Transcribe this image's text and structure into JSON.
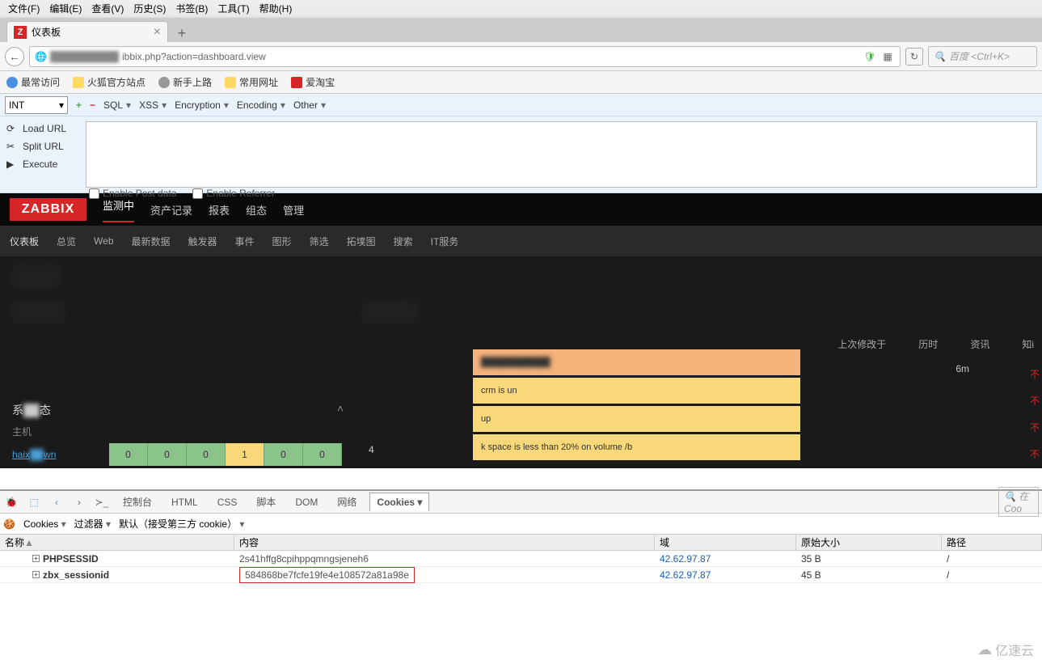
{
  "browser": {
    "menu": [
      "文件(F)",
      "编辑(E)",
      "查看(V)",
      "历史(S)",
      "书签(B)",
      "工具(T)",
      "帮助(H)"
    ],
    "tab_title": "仪表板",
    "url": "ibbix.php?action=dashboard.view",
    "search_placeholder": "百度 <Ctrl+K>",
    "bookmarks": [
      {
        "icon": "bm-blue",
        "label": "最常访问"
      },
      {
        "icon": "bm-folder",
        "label": "火狐官方站点"
      },
      {
        "icon": "bm-grey",
        "label": "新手上路"
      },
      {
        "icon": "bm-folder",
        "label": "常用网址"
      },
      {
        "icon": "bm-red",
        "label": "爱淘宝"
      }
    ]
  },
  "hackbar": {
    "select_value": "INT",
    "menus": [
      "SQL",
      "XSS",
      "Encryption",
      "Encoding",
      "Other"
    ],
    "actions": [
      {
        "label": "Load URL",
        "underline": "L"
      },
      {
        "label": "Split URL",
        "underline": "S"
      },
      {
        "label": "Execute",
        "underline": "E"
      }
    ],
    "opt_post": "Enable Post data",
    "opt_referrer": "Enable Referrer"
  },
  "zabbix": {
    "logo": "ZABBIX",
    "top_nav": [
      "监测中",
      "资产记录",
      "报表",
      "组态",
      "管理"
    ],
    "sub_nav": [
      "仪表板",
      "总览",
      "Web",
      "最新数据",
      "触发器",
      "事件",
      "图形",
      "筛选",
      "拓墣图",
      "搜索",
      "IT服务"
    ],
    "headers": {
      "last_change": "上次修改于",
      "age": "历时",
      "info": "资讯",
      "ack": "知i"
    },
    "age_value": "6m",
    "status_title_partial": "系",
    "status_title_rest": "态",
    "host_label": "主机",
    "host_name_partial1": "haix",
    "host_name_partial2": "wn",
    "status_values": [
      "0",
      "0",
      "0",
      "1",
      "0",
      "0"
    ],
    "extra_val": "4",
    "red_mark": "不",
    "alerts": [
      {
        "class": "ar1",
        "text": ""
      },
      {
        "class": "ar2",
        "text": "crm is un"
      },
      {
        "class": "ar3",
        "text": "up"
      },
      {
        "class": "ar4",
        "text": "k space is less than 20% on volume /b"
      }
    ]
  },
  "devtools": {
    "tabs": [
      "控制台",
      "HTML",
      "CSS",
      "脚本",
      "DOM",
      "网络",
      "Cookies"
    ],
    "active_tab": "Cookies",
    "search_placeholder": "在 Coo",
    "sub_items": [
      "Cookies",
      "过滤器",
      "默认（接受第三方 cookie）"
    ],
    "columns": {
      "name": "名称",
      "content": "内容",
      "domain": "域",
      "size": "原始大小",
      "path": "路径"
    },
    "rows": [
      {
        "name": "PHPSESSID",
        "content": "2s41hffg8cpihppqmngsjeneh6",
        "domain": "42.62.97.87",
        "size": "35 B",
        "path": "/"
      },
      {
        "name": "zbx_sessionid",
        "content": "584868be7fcfe19fe4e108572a81a98e",
        "domain": "42.62.97.87",
        "size": "45 B",
        "path": "/",
        "highlight": true
      }
    ]
  },
  "watermark": "亿速云"
}
